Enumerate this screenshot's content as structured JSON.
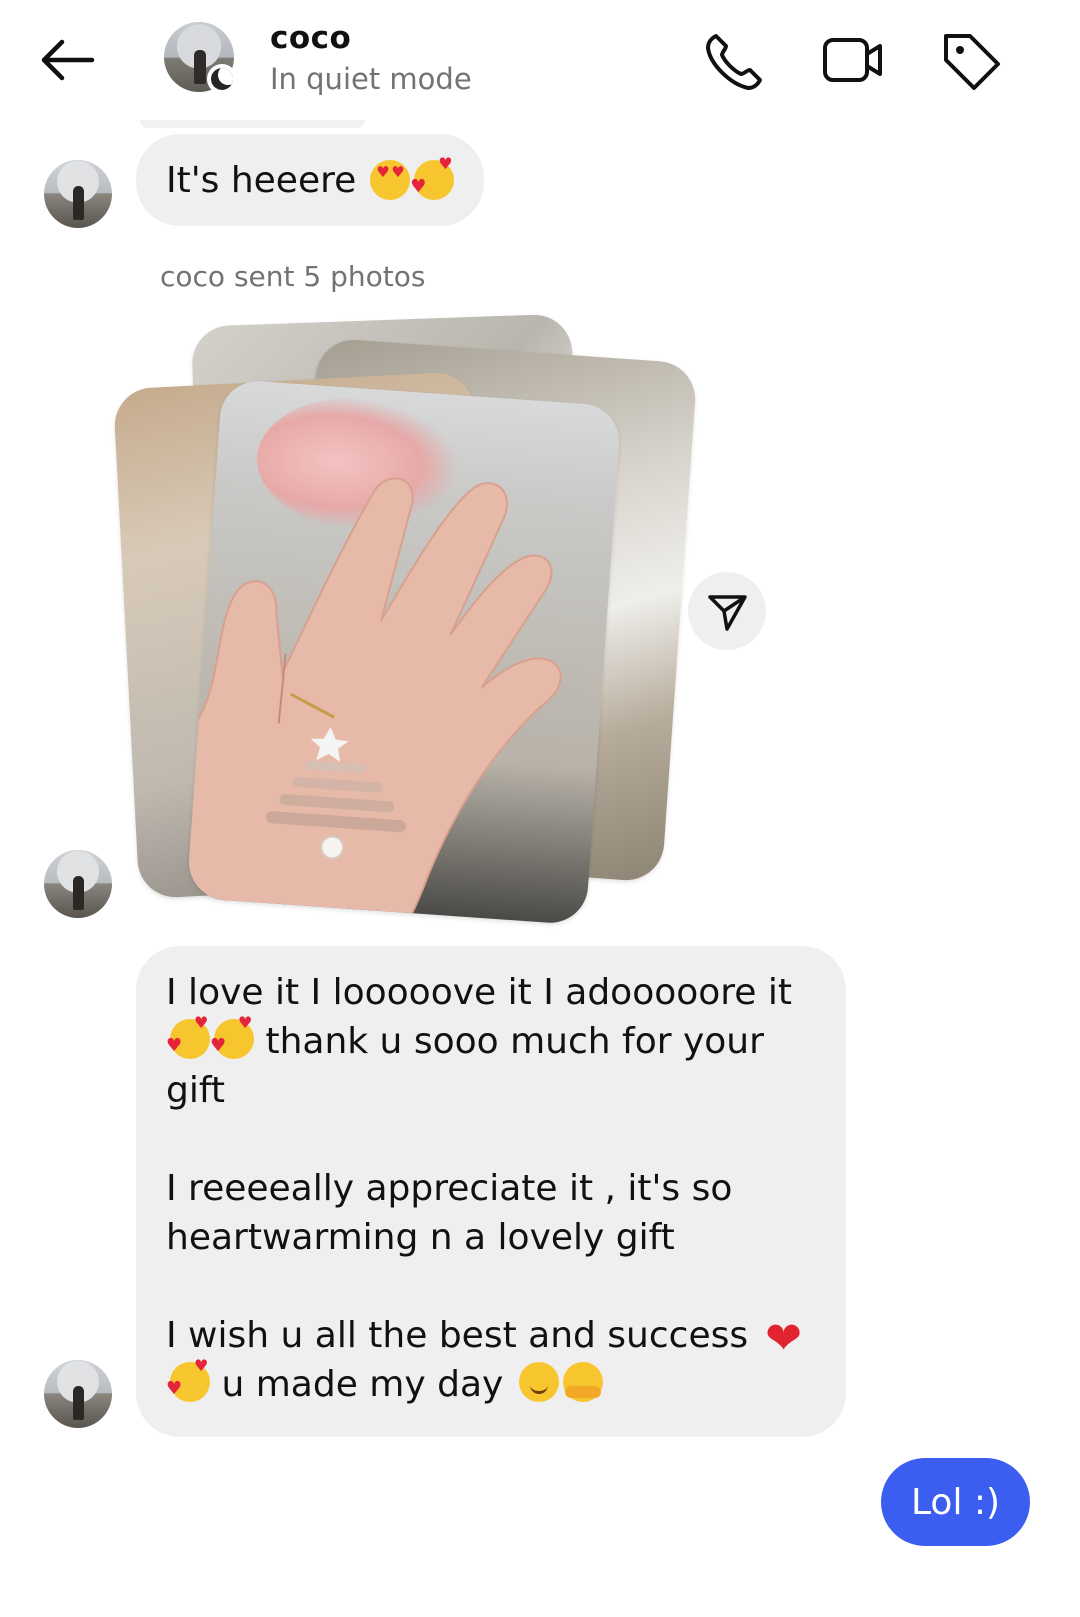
{
  "header": {
    "back_icon": "arrow-left-icon",
    "contact_name": "coco",
    "status": "In quiet mode",
    "icons": [
      "phone-icon",
      "video-call-icon",
      "tag-icon"
    ]
  },
  "messages": {
    "m1_text": "It's heeere",
    "photos_caption": "coco sent 5 photos",
    "m2_line1": "I love it I looooove it I adooooore it",
    "m2_line2": "thank u sooo much for your gift",
    "m2_para2": "I reeeeally appreciate it , it's so heartwarming n a lovely gift",
    "m2_para3a": "I wish u all the best and success",
    "m2_para3b": "u made my day",
    "m3_text": "Lol :)"
  },
  "colors": {
    "incoming_bubble": "#efefef",
    "outgoing_bubble": "#3c5ef0",
    "secondary_text": "#737373"
  }
}
